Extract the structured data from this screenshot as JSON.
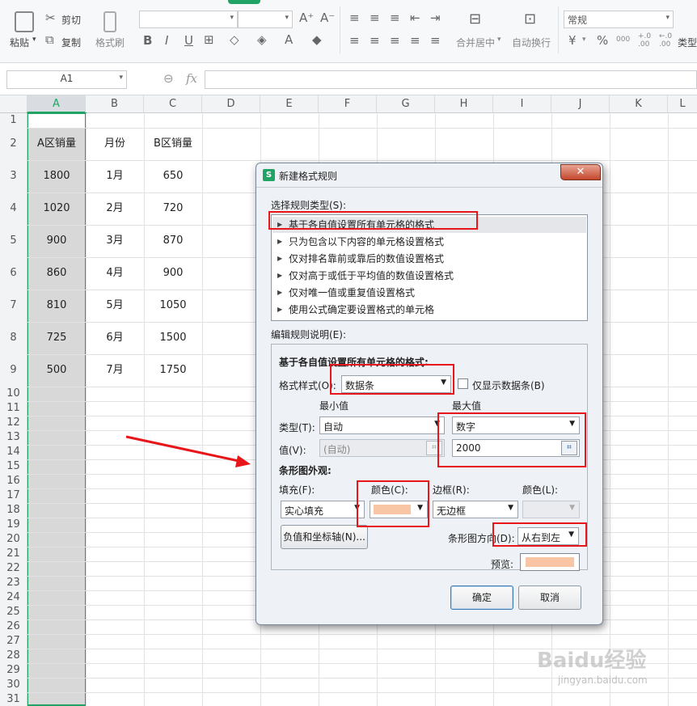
{
  "ribbon": {
    "paste": "粘贴",
    "cut": "剪切",
    "copy": "复制",
    "format_painter": "格式刷",
    "number_format": "常规",
    "merge_center": "合并居中",
    "wrap_text": "自动换行",
    "type_label": "类型",
    "currency_symbol": "¥",
    "percent_symbol": "%",
    "thousands_symbol": "000",
    "dec_inc": "+.0 .00",
    "dec_dec": "←.0 .00",
    "font_bold": "B",
    "font_italic": "I",
    "font_underline": "U",
    "font_grow": "A⁺",
    "font_shrink": "A⁻",
    "font_color": "A"
  },
  "formula_bar": {
    "cell_ref": "A1",
    "fx": "fx",
    "zoom_icon": "⊖"
  },
  "columns": [
    "A",
    "B",
    "C",
    "D",
    "E",
    "F",
    "G",
    "H",
    "I",
    "J",
    "K",
    "L"
  ],
  "rows": [
    "1",
    "2",
    "3",
    "4",
    "5",
    "6",
    "7",
    "8",
    "9",
    "10",
    "11",
    "12",
    "13",
    "14",
    "15",
    "16",
    "17",
    "18",
    "19",
    "20",
    "21",
    "22",
    "23",
    "24",
    "25",
    "26",
    "27",
    "28",
    "29",
    "30",
    "31"
  ],
  "table": {
    "headers": [
      "A区销量",
      "月份",
      "B区销量"
    ],
    "rows": [
      [
        "1800",
        "1月",
        "650"
      ],
      [
        "1020",
        "2月",
        "720"
      ],
      [
        "900",
        "3月",
        "870"
      ],
      [
        "860",
        "4月",
        "900"
      ],
      [
        "810",
        "5月",
        "1050"
      ],
      [
        "725",
        "6月",
        "1500"
      ],
      [
        "500",
        "7月",
        "1750"
      ]
    ]
  },
  "dialog": {
    "title": "新建格式规则",
    "select_rule_type": "选择规则类型(S):",
    "rules": [
      "基于各自值设置所有单元格的格式",
      "只为包含以下内容的单元格设置格式",
      "仅对排名靠前或靠后的数值设置格式",
      "仅对高于或低于平均值的数值设置格式",
      "仅对唯一值或重复值设置格式",
      "使用公式确定要设置格式的单元格"
    ],
    "edit_rule_desc": "编辑规则说明(E):",
    "format_all_label": "基于各自值设置所有单元格的格式:",
    "format_style_label": "格式样式(O):",
    "format_style_value": "数据条",
    "show_bar_only": "仅显示数据条(B)",
    "min_label": "最小值",
    "max_label": "最大值",
    "type_label": "类型(T):",
    "min_type": "自动",
    "max_type": "数字",
    "value_label": "值(V):",
    "min_value": "(自动)",
    "max_value": "2000",
    "bar_appearance": "条形图外观:",
    "fill_label": "填充(F):",
    "fill_value": "实心填充",
    "color_label": "颜色(C):",
    "border_label": "边框(R):",
    "border_value": "无边框",
    "border_color_label": "颜色(L):",
    "neg_axis_button": "负值和坐标轴(N)...",
    "bar_direction_label": "条形图方向(D):",
    "bar_direction_value": "从右到左",
    "preview_label": "预览:",
    "ok": "确定",
    "cancel": "取消"
  },
  "colors": {
    "accent_green": "#21a366",
    "bar_fill": "#f8c6a4",
    "highlight_red": "#e8161a"
  },
  "watermark": {
    "text": "Baidu经验",
    "url": "jingyan.baidu.com"
  }
}
